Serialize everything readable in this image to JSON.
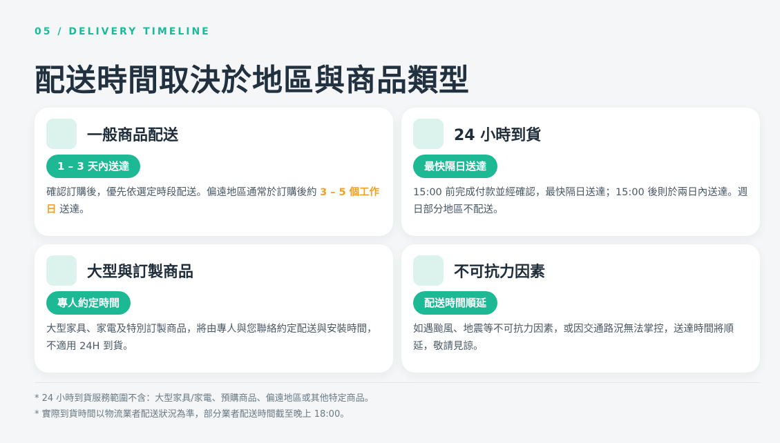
{
  "header": {
    "eyebrow": "05 / DELIVERY TIMELINE",
    "title": "配送時間取決於地區與商品類型"
  },
  "colors": {
    "accent": "#1db894",
    "highlight": "#f2a022",
    "icon_bg": "#dcf2ec",
    "title": "#22313f"
  },
  "cards": [
    {
      "title": "一般商品配送",
      "badge": "1 – 3 天內送達",
      "desc_pre": "確認訂購後，優先依選定時段配送。偏遠地區通常於訂購後約 ",
      "desc_hl": "3 – 5 個工作日",
      "desc_post": " 送達。"
    },
    {
      "title": "24 小時到貨",
      "badge": "最快隔日送達",
      "desc": "15:00 前完成付款並經確認，最快隔日送達；15:00 後則於兩日內送達。週日部分地區不配送。"
    },
    {
      "title": "大型與訂製商品",
      "badge": "專人約定時間",
      "desc": "大型家具、家電及特別訂製商品，將由專人與您聯絡約定配送與安裝時間，不適用 24H 到貨。"
    },
    {
      "title": "不可抗力因素",
      "badge": "配送時間順延",
      "desc": "如遇颱風、地震等不可抗力因素，或因交通路況無法掌控，送達時間將順延，敬請見諒。"
    }
  ],
  "notes": [
    "* 24 小時到貨服務範圍不含：大型家具/家電、預購商品、偏遠地區或其他特定商品。",
    "* 實際到貨時間以物流業者配送狀況為準，部分業者配送時間截至晚上 18:00。"
  ]
}
